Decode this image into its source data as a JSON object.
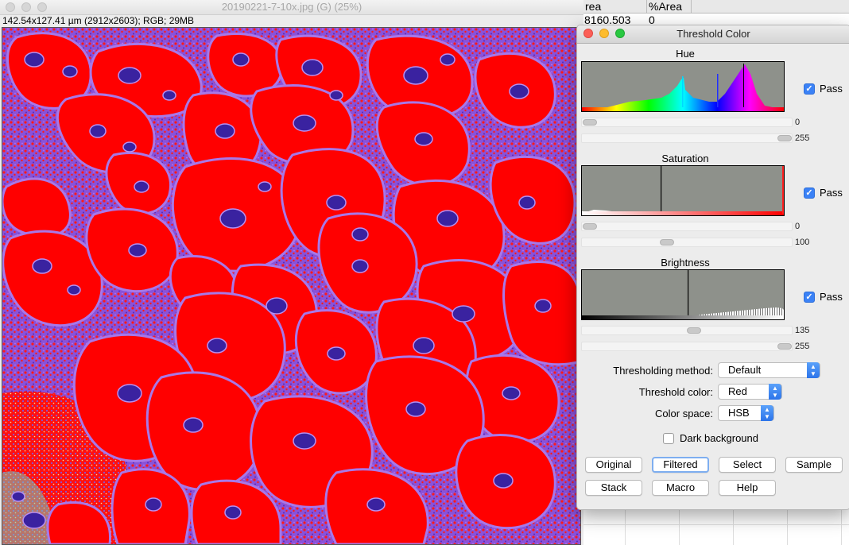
{
  "image_window": {
    "title": "20190221-7-10x.jpg (G) (25%)",
    "info": "142.54x127.41 µm (2912x2603); RGB; 29MB"
  },
  "results": {
    "headers": [
      "rea",
      "%Area"
    ],
    "row": [
      "8160.503",
      "0"
    ]
  },
  "dialog": {
    "title": "Threshold Color",
    "sections": [
      {
        "label": "Hue",
        "pass_label": "Pass",
        "pass_checked": true,
        "min_value": "0",
        "max_value": "255"
      },
      {
        "label": "Saturation",
        "pass_label": "Pass",
        "pass_checked": true,
        "min_value": "0",
        "max_value": "100"
      },
      {
        "label": "Brightness",
        "pass_label": "Pass",
        "pass_checked": true,
        "min_value": "135",
        "max_value": "255"
      }
    ],
    "thresholding_method": {
      "label": "Thresholding method:",
      "value": "Default"
    },
    "threshold_color": {
      "label": "Threshold color:",
      "value": "Red"
    },
    "color_space": {
      "label": "Color space:",
      "value": "HSB"
    },
    "dark_background": {
      "label": "Dark background",
      "checked": false
    },
    "buttons": {
      "original": "Original",
      "filtered": "Filtered",
      "select": "Select",
      "sample": "Sample",
      "stack": "Stack",
      "macro": "Macro",
      "help": "Help"
    }
  },
  "colors": {
    "threshold_red": "#ff0000",
    "tissue_purple": "#7a4fd0",
    "nucleus_dark": "#2a1a7a",
    "checkbox_blue": "#3b82f6",
    "histogram_bg": "#8e918b"
  }
}
